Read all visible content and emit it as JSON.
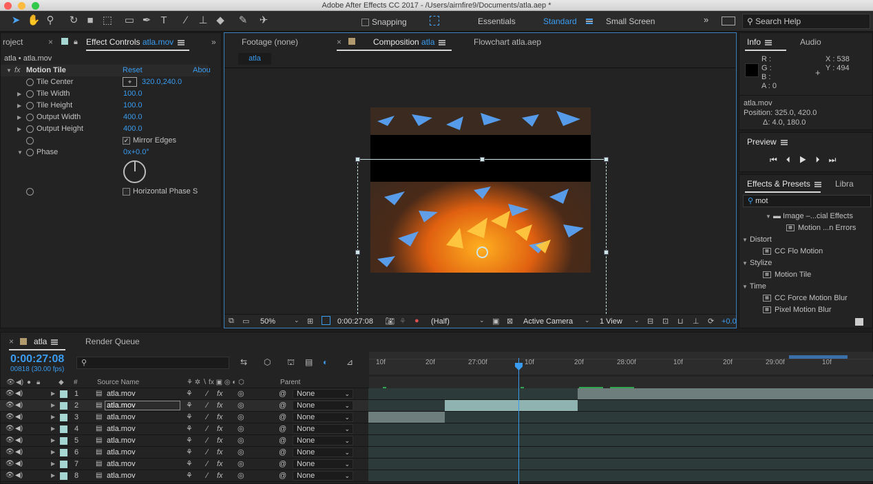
{
  "window": {
    "title": "Adobe After Effects CC 2017 - /Users/airnfire9/Documents/atla.aep *"
  },
  "toolbar": {
    "tools": [
      "selection-tool",
      "hand-tool",
      "zoom-tool",
      "rotate-tool",
      "camera-tool",
      "pan-behind-tool",
      "rectangle-tool",
      "pen-tool",
      "type-tool",
      "brush-tool",
      "clone-stamp-tool",
      "eraser-tool",
      "roto-brush-tool",
      "puppet-pin-tool"
    ],
    "snapping_label": "Snapping",
    "workspaces": [
      "Essentials",
      "Standard",
      "Small Screen"
    ],
    "active_workspace": "Standard",
    "search_placeholder": "Search Help"
  },
  "effect_controls": {
    "project_tab": "roject",
    "tab_label": "Effect Controls",
    "tab_file": "atla.mov",
    "breadcrumb": "atla • atla.mov",
    "effect_name": "Motion Tile",
    "reset_label": "Reset",
    "about_label": "Abou",
    "params": [
      {
        "name": "Tile Center",
        "value": "320.0,240.0"
      },
      {
        "name": "Tile Width",
        "value": "100.0"
      },
      {
        "name": "Tile Height",
        "value": "100.0"
      },
      {
        "name": "Output Width",
        "value": "400.0"
      },
      {
        "name": "Output Height",
        "value": "400.0"
      }
    ],
    "mirror_edges_label": "Mirror Edges",
    "phase_label": "Phase",
    "phase_value": "0x+0.0°",
    "horizontal_phase_label": "Horizontal Phase S"
  },
  "viewer": {
    "tabs": [
      "Footage (none)",
      "Composition",
      "Flowchart atla.aep"
    ],
    "comp_name": "atla",
    "comp_button": "atla",
    "zoom": "50%",
    "timecode": "0:00:27:08",
    "resolution": "(Half)",
    "camera": "Active Camera",
    "views": "1 View",
    "exposure": "+0.0"
  },
  "info": {
    "tab": "Info",
    "audio_tab": "Audio",
    "r": "R :",
    "g": "G :",
    "b": "B :",
    "a": "A : 0",
    "x": "X : 538",
    "y": "Y : 494",
    "layer": "atla.mov",
    "position": "Position: 325.0, 420.0",
    "delta": "Δ: 4.0, 180.0"
  },
  "preview": {
    "tab": "Preview"
  },
  "effects_presets": {
    "tab": "Effects & Presets",
    "lib_tab": "Libra",
    "search_value": "mot",
    "items": [
      {
        "type": "folder",
        "label": "Image –...cial Effects"
      },
      {
        "type": "effect",
        "label": "Motion ...n Errors"
      },
      {
        "type": "category",
        "label": "Distort"
      },
      {
        "type": "effect",
        "label": "CC Flo Motion"
      },
      {
        "type": "category",
        "label": "Stylize"
      },
      {
        "type": "effect",
        "label": "Motion Tile"
      },
      {
        "type": "category",
        "label": "Time"
      },
      {
        "type": "effect",
        "label": "CC Force Motion Blur"
      },
      {
        "type": "effect",
        "label": "Pixel Motion Blur"
      }
    ]
  },
  "timeline": {
    "comp_tab": "atla",
    "render_tab": "Render Queue",
    "timecode": "0:00:27:08",
    "frame_info": "00818 (30.00 fps)",
    "col_num": "#",
    "col_source": "Source Name",
    "col_parent": "Parent",
    "ruler": [
      "10f",
      "20f",
      "27:00f",
      "10f",
      "20f",
      "28:00f",
      "10f",
      "20f",
      "29:00f",
      "10f"
    ],
    "layers": [
      {
        "num": "1",
        "name": "atla.mov",
        "parent": "None"
      },
      {
        "num": "2",
        "name": "atla.mov",
        "parent": "None"
      },
      {
        "num": "3",
        "name": "atla.mov",
        "parent": "None"
      },
      {
        "num": "4",
        "name": "atla.mov",
        "parent": "None"
      },
      {
        "num": "5",
        "name": "atla.mov",
        "parent": "None"
      },
      {
        "num": "6",
        "name": "atla.mov",
        "parent": "None"
      },
      {
        "num": "7",
        "name": "atla.mov",
        "parent": "None"
      },
      {
        "num": "8",
        "name": "atla.mov",
        "parent": "None"
      }
    ]
  }
}
